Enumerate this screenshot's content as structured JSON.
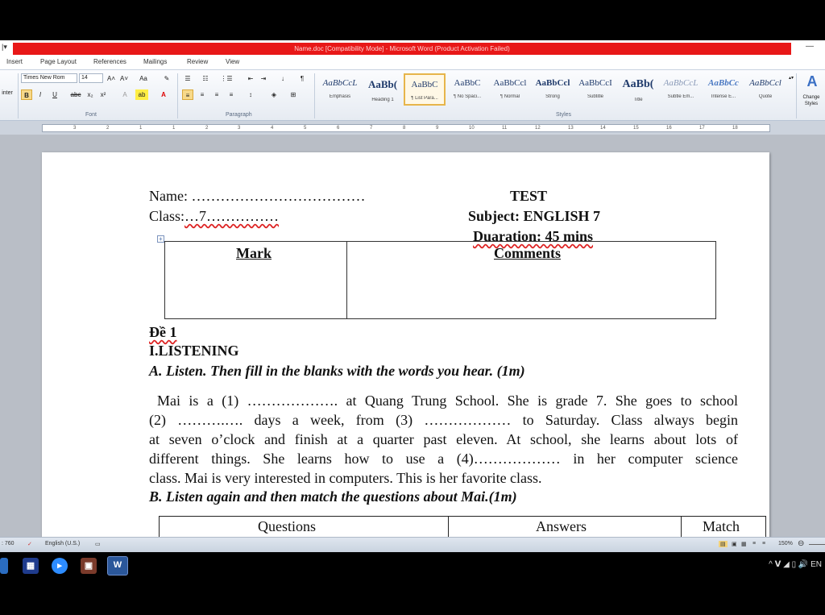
{
  "window": {
    "title": "Name.doc [Compatibility Mode] - Microsoft Word (Product Activation Failed)",
    "minimize_glyph": "—"
  },
  "ribbon_tabs": [
    "Insert",
    "Page Layout",
    "References",
    "Mailings",
    "Review",
    "View"
  ],
  "ribbon": {
    "font_name": "Times New Rom",
    "font_size": "14",
    "group_font": "Font",
    "group_paragraph": "Paragraph",
    "group_styles": "Styles",
    "clipboard_partial": "inter",
    "change_styles": "Change Styles",
    "styles": [
      {
        "sample": "AaBbCcL",
        "name": "Emphasis"
      },
      {
        "sample": "AaBb(",
        "name": "Heading 1"
      },
      {
        "sample": "AaBbC",
        "name": "¶ List Para..."
      },
      {
        "sample": "AaBbC",
        "name": "¶ No Spaci..."
      },
      {
        "sample": "AaBbCcl",
        "name": "¶ Normal"
      },
      {
        "sample": "AaBbCcl",
        "name": "Strong"
      },
      {
        "sample": "AaBbCcI",
        "name": "Subtitle"
      },
      {
        "sample": "AaBb(",
        "name": "Title"
      },
      {
        "sample": "AaBbCcL",
        "name": "Subtle Em..."
      },
      {
        "sample": "AaBbCc",
        "name": "Intense E..."
      },
      {
        "sample": "AaBbCcl",
        "name": "Quote"
      }
    ]
  },
  "ruler_numbers": [
    "3",
    "2",
    "1",
    "1",
    "2",
    "3",
    "4",
    "5",
    "6",
    "7",
    "8",
    "9",
    "10",
    "11",
    "12",
    "13",
    "14",
    "15",
    "16",
    "17",
    "18"
  ],
  "document": {
    "name_line": "Name: ………………………………",
    "class_label": "Class:",
    "class_value": "…7……………",
    "test_title": "TEST",
    "subject": "Subject: ENGLISH 7",
    "duration": "Duaration: 45 mins",
    "mark_header": "Mark",
    "comments_header": "Comments",
    "de": "Đề 1",
    "section": "I.LISTENING",
    "task_a": "A. Listen. Then fill in the blanks with the words you hear. (1m)",
    "paragraph": [
      "Mai is a (1) ………………. at Quang Trung School. She is grade 7. She goes to school",
      "(2) ……….…. days a week, from (3) ……………… to Saturday. Class always begin",
      "at seven o’clock and finish at a quarter past eleven. At school, she learns about lots of",
      "different things. She learns how to use a (4)……………… in her computer science",
      "class. Mai is very interested in computers. This is her favorite class."
    ],
    "task_b": "B. Listen again and then match the questions about Mai.(1m)",
    "table_headers": [
      "Questions",
      "Answers",
      "Match"
    ]
  },
  "status": {
    "words": ": 760",
    "language": "English (U.S.)",
    "zoom": "150%"
  },
  "taskbar": {
    "apps": [
      "explorer-icon",
      "app-icon",
      "zoom-icon",
      "media-icon",
      "word-icon"
    ],
    "tray": "^ 𝗩 ◢ ▯ 🔊 EN"
  }
}
